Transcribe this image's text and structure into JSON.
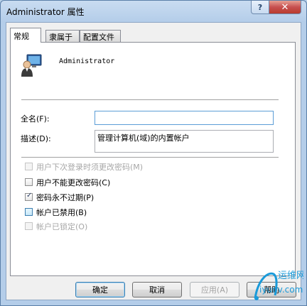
{
  "window": {
    "title": "Administrator 属性",
    "help_label": "?",
    "close_label": "✕"
  },
  "tabs": [
    {
      "label": "常规",
      "active": true
    },
    {
      "label": "隶属于",
      "active": false
    },
    {
      "label": "配置文件",
      "active": false
    }
  ],
  "general": {
    "username": "Administrator",
    "fullname_label": "全名(F):",
    "fullname_value": "",
    "description_label": "描述(D):",
    "description_value": "管理计算机(域)的内置帐户",
    "checkboxes": [
      {
        "label": "用户下次登录时须更改密码(M)",
        "checked": false,
        "enabled": false
      },
      {
        "label": "用户不能更改密码(C)",
        "checked": false,
        "enabled": true
      },
      {
        "label": "密码永不过期(P)",
        "checked": true,
        "enabled": true
      },
      {
        "label": "帐户已禁用(B)",
        "checked": false,
        "enabled": true
      },
      {
        "label": "帐户已锁定(O)",
        "checked": false,
        "enabled": false
      }
    ]
  },
  "buttons": {
    "ok": "确定",
    "cancel": "取消",
    "apply": "应用(A)",
    "help": "帮助"
  },
  "watermark": {
    "text": "运维网",
    "url": "iyunv.com"
  },
  "colors": {
    "title_bar": "#b4cde9",
    "close_button": "#c75050",
    "accent_focus": "#5c9dd6",
    "watermark": "#1a9ad9"
  }
}
